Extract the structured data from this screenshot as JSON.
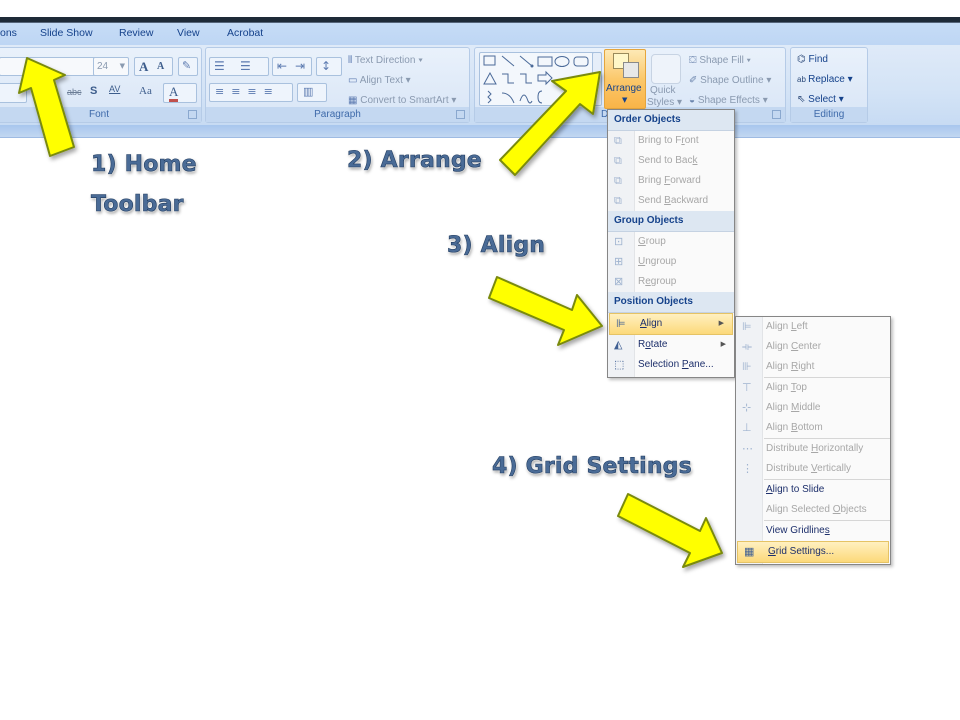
{
  "app": {
    "tabs": [
      "ons",
      "Slide Show",
      "Review",
      "View",
      "Acrobat"
    ]
  },
  "ribbon": {
    "font_group": {
      "label": "Font",
      "font_size_value": "24",
      "grow_font_icon": "grow-font-icon",
      "shrink_font_icon": "shrink-font-icon",
      "clear_formatting_icon": "clear-formatting-icon",
      "strikethrough_label": "abc",
      "shadow_label": "S",
      "char_spacing_label": "AV",
      "change_case_label": "Aa",
      "font_color_label": "A"
    },
    "paragraph_group": {
      "label": "Paragraph",
      "text_direction": "Text Direction",
      "align_text": "Align Text",
      "convert_smartart": "Convert to SmartArt"
    },
    "drawing_group": {
      "label": "D",
      "arrange": "Arrange",
      "quick_styles_1": "Quick",
      "quick_styles_2": "Styles",
      "shape_fill": "Shape Fill",
      "shape_outline": "Shape Outline",
      "shape_effects": "Shape Effects"
    },
    "editing_group": {
      "label": "Editing",
      "find": "Find",
      "replace": "Replace",
      "select": "Select"
    }
  },
  "arrange_menu": {
    "sections": [
      {
        "header": "Order Objects",
        "items": [
          {
            "label": "Bring to Front",
            "pre": "Bring to F",
            "u": "r",
            "post": "ont",
            "enabled": false,
            "icon": "bring-to-front-icon"
          },
          {
            "label": "Send to Back",
            "pre": "Send to Bac",
            "u": "k",
            "post": "",
            "enabled": false,
            "icon": "send-to-back-icon"
          },
          {
            "label": "Bring Forward",
            "pre": "Bring ",
            "u": "F",
            "post": "orward",
            "enabled": false,
            "icon": "bring-forward-icon"
          },
          {
            "label": "Send Backward",
            "pre": "Send ",
            "u": "B",
            "post": "ackward",
            "enabled": false,
            "icon": "send-backward-icon"
          }
        ]
      },
      {
        "header": "Group Objects",
        "items": [
          {
            "label": "Group",
            "pre": "",
            "u": "G",
            "post": "roup",
            "enabled": false,
            "icon": "group-icon"
          },
          {
            "label": "Ungroup",
            "pre": "",
            "u": "U",
            "post": "ngroup",
            "enabled": false,
            "icon": "ungroup-icon"
          },
          {
            "label": "Regroup",
            "pre": "R",
            "u": "e",
            "post": "group",
            "enabled": false,
            "icon": "regroup-icon"
          }
        ]
      },
      {
        "header": "Position Objects",
        "items": [
          {
            "label": "Align",
            "pre": "",
            "u": "A",
            "post": "lign",
            "enabled": true,
            "highlighted": true,
            "submenu": true,
            "icon": "align-icon"
          },
          {
            "label": "Rotate",
            "pre": "R",
            "u": "o",
            "post": "tate",
            "enabled": true,
            "submenu": true,
            "icon": "rotate-icon"
          },
          {
            "label": "Selection Pane...",
            "pre": "Selection ",
            "u": "P",
            "post": "ane...",
            "enabled": true,
            "icon": "selection-pane-icon"
          }
        ]
      }
    ]
  },
  "align_submenu": {
    "items": [
      {
        "label": "Align Left",
        "pre": "Align ",
        "u": "L",
        "post": "eft",
        "enabled": false,
        "icon": "align-left-icon"
      },
      {
        "label": "Align Center",
        "pre": "Align ",
        "u": "C",
        "post": "enter",
        "enabled": false,
        "icon": "align-center-icon"
      },
      {
        "label": "Align Right",
        "pre": "Align ",
        "u": "R",
        "post": "ight",
        "enabled": false,
        "icon": "align-right-icon",
        "sep_after": true
      },
      {
        "label": "Align Top",
        "pre": "Align ",
        "u": "T",
        "post": "op",
        "enabled": false,
        "icon": "align-top-icon"
      },
      {
        "label": "Align Middle",
        "pre": "Align ",
        "u": "M",
        "post": "iddle",
        "enabled": false,
        "icon": "align-middle-icon"
      },
      {
        "label": "Align Bottom",
        "pre": "Align ",
        "u": "B",
        "post": "ottom",
        "enabled": false,
        "icon": "align-bottom-icon",
        "sep_after": true
      },
      {
        "label": "Distribute Horizontally",
        "pre": "Distribute ",
        "u": "H",
        "post": "orizontally",
        "enabled": false,
        "icon": "distribute-horizontally-icon"
      },
      {
        "label": "Distribute Vertically",
        "pre": "Distribute ",
        "u": "V",
        "post": "ertically",
        "enabled": false,
        "icon": "distribute-vertically-icon",
        "sep_after": true
      },
      {
        "label": "Align to Slide",
        "pre": "",
        "u": "A",
        "post": "lign to Slide",
        "enabled": true,
        "icon": ""
      },
      {
        "label": "Align Selected Objects",
        "pre": "Align Selected ",
        "u": "O",
        "post": "bjects",
        "enabled": false,
        "icon": "",
        "sep_after": true
      },
      {
        "label": "View Gridlines",
        "pre": "View Gridline",
        "u": "s",
        "post": "",
        "enabled": true,
        "icon": ""
      },
      {
        "label": "Grid Settings...",
        "pre": "",
        "u": "G",
        "post": "rid Settings...",
        "enabled": true,
        "highlighted": true,
        "icon": "grid-settings-icon"
      }
    ]
  },
  "annotations": {
    "step1_line1": "1) Home",
    "step1_line2": "Toolbar",
    "step2": "2) Arrange",
    "step3": "3) Align",
    "step4": "4) Grid Settings"
  },
  "colors": {
    "ribbon_text": "#15428b",
    "arrow_fill": "#ffff00",
    "arrow_stroke": "#7a8a10",
    "annotation_text": "#4a6b96",
    "highlight": "#fcd97a"
  }
}
